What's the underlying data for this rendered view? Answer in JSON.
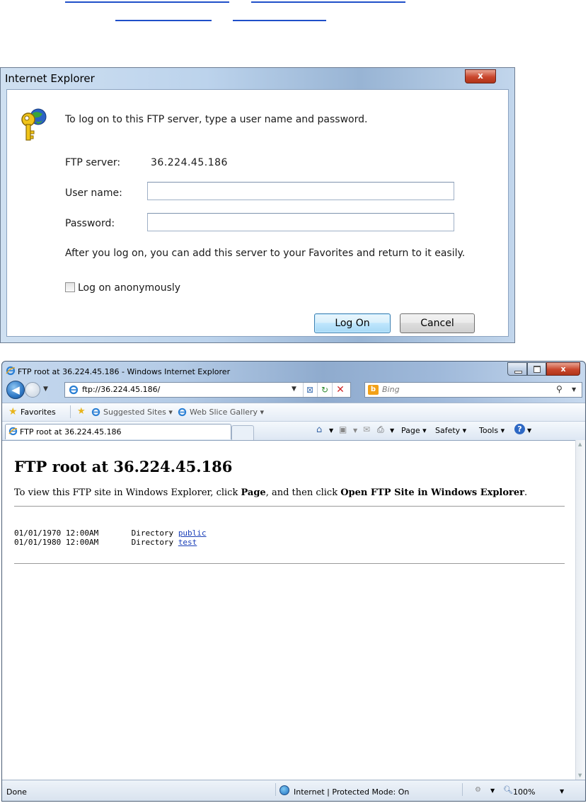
{
  "dialog": {
    "title": "Internet Explorer",
    "close_label": "x",
    "message": "To log on to this FTP server, type a user name and password.",
    "server_label": "FTP server:",
    "server_value": "36.224.45.186",
    "username_label": "User name:",
    "username_value": "",
    "password_label": "Password:",
    "password_value": "",
    "hint": "After you log on, you can add this server to your Favorites and return to it easily.",
    "anonymous_label": "Log on anonymously",
    "logon_button": "Log On",
    "cancel_button": "Cancel"
  },
  "browser": {
    "window_title": "FTP root at 36.224.45.186 - Windows Internet Explorer",
    "address": "ftp://36.224.45.186/",
    "search_placeholder": "Bing",
    "favorites_label": "Favorites",
    "suggested_sites": "Suggested Sites ▾",
    "web_slice_gallery": "Web Slice Gallery ▾",
    "tab_title": "FTP root at 36.224.45.186",
    "menus": {
      "page": "Page ▾",
      "safety": "Safety ▾",
      "tools": "Tools ▾"
    },
    "status": {
      "left": "Done",
      "zone": "Internet | Protected Mode: On",
      "zoom": "100%"
    }
  },
  "page": {
    "heading": "FTP root at 36.224.45.186",
    "instruction": {
      "p1": "To view this FTP site in Windows Explorer, click ",
      "b1": "Page",
      "p2": ", and then click ",
      "b2": "Open FTP Site in Windows Explorer",
      "p3": "."
    },
    "entries": [
      {
        "date": "01/01/1970 12:00AM",
        "type": "Directory",
        "name": "public"
      },
      {
        "date": "01/01/1980 12:00AM",
        "type": "Directory",
        "name": "test"
      }
    ]
  }
}
